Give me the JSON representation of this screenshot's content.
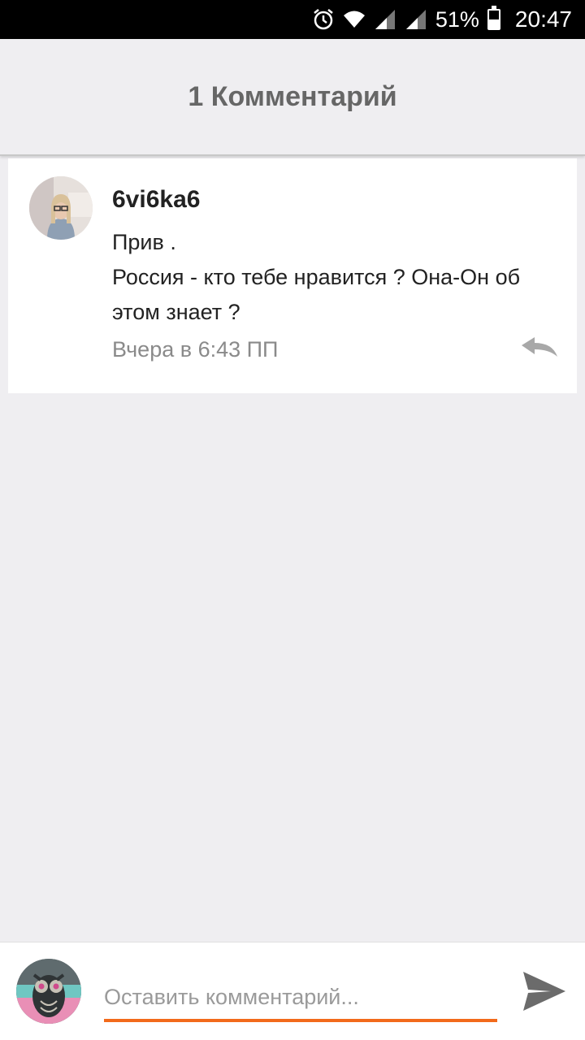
{
  "status_bar": {
    "battery_percent": "51%",
    "time": "20:47"
  },
  "header": {
    "title": "1 Комментарий"
  },
  "comments": [
    {
      "author": "6vi6ka6",
      "text_line1": "Прив .",
      "text_line2": "Россия - кто тебе нравится ? Она-Он об этом знает ?",
      "timestamp": "Вчера в 6:43 ПП"
    }
  ],
  "composer": {
    "placeholder": "Оставить комментарий..."
  },
  "colors": {
    "accent": "#f26a1b",
    "background": "#efeef1"
  }
}
